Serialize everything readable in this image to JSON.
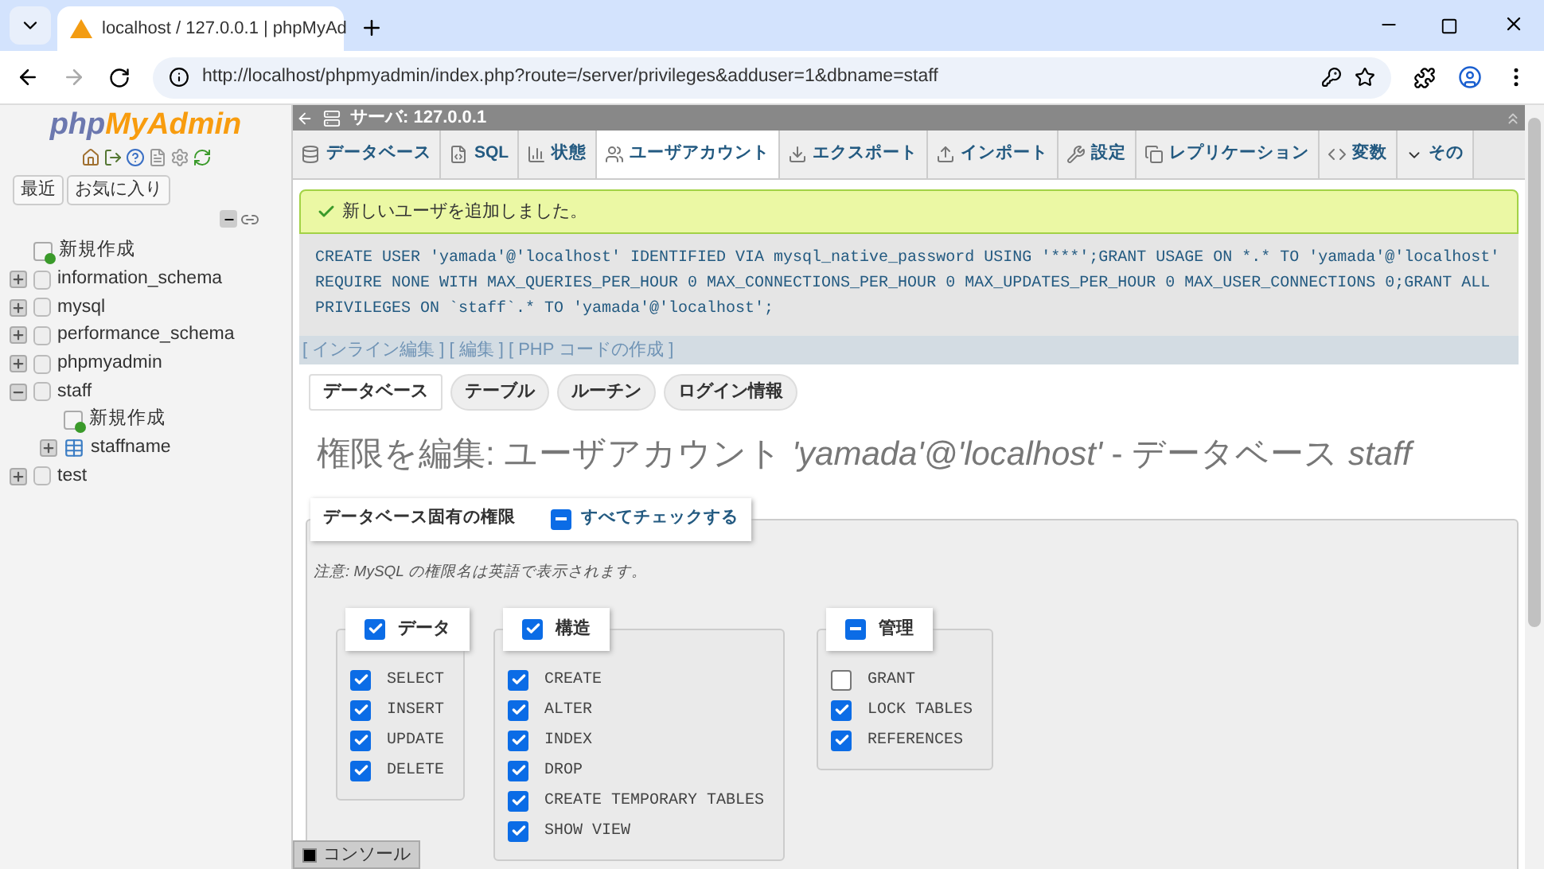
{
  "browser": {
    "tab_title": "localhost / 127.0.0.1 | phpMyAd",
    "url": "http://localhost/phpmyadmin/index.php?route=/server/privileges&adduser=1&dbname=staff"
  },
  "sidebar": {
    "logo_php": "php",
    "logo_rest": "MyAdmin",
    "buttons": [
      "最近",
      "お気に入り"
    ],
    "tree": [
      {
        "label": "新規作成",
        "kind": "new"
      },
      {
        "label": "information_schema",
        "kind": "db",
        "expanded": false
      },
      {
        "label": "mysql",
        "kind": "db",
        "expanded": false
      },
      {
        "label": "performance_schema",
        "kind": "db",
        "expanded": false
      },
      {
        "label": "phpmyadmin",
        "kind": "db",
        "expanded": false
      },
      {
        "label": "staff",
        "kind": "db",
        "expanded": true,
        "children": [
          {
            "label": "新規作成",
            "kind": "new"
          },
          {
            "label": "staffname",
            "kind": "table",
            "expanded": false
          }
        ]
      },
      {
        "label": "test",
        "kind": "db",
        "expanded": false
      }
    ]
  },
  "breadcrumb": "サーバ: 127.0.0.1",
  "tabs": [
    {
      "label": "データベース",
      "selected": false
    },
    {
      "label": "SQL",
      "selected": false
    },
    {
      "label": "状態",
      "selected": false
    },
    {
      "label": "ユーザアカウント",
      "selected": true
    },
    {
      "label": "エクスポート",
      "selected": false
    },
    {
      "label": "インポート",
      "selected": false
    },
    {
      "label": "設定",
      "selected": false
    },
    {
      "label": "レプリケーション",
      "selected": false
    },
    {
      "label": "変数",
      "selected": false
    },
    {
      "label": "その",
      "selected": false
    }
  ],
  "success_message": "新しいユーザを追加しました。",
  "sql": "CREATE USER 'yamada'@'localhost' IDENTIFIED VIA mysql_native_password USING '***';GRANT USAGE ON *.* TO 'yamada'@'localhost' REQUIRE NONE WITH MAX_QUERIES_PER_HOUR 0 MAX_CONNECTIONS_PER_HOUR 0 MAX_UPDATES_PER_HOUR 0 MAX_USER_CONNECTIONS 0;GRANT ALL PRIVILEGES ON `staff`.* TO 'yamada'@'localhost';",
  "sql_links": [
    "[ インライン編集 ]",
    "[ 編集 ]",
    "[ PHP コードの作成 ]"
  ],
  "sub_tabs": [
    {
      "label": "データベース",
      "selected": true
    },
    {
      "label": "テーブル",
      "selected": false
    },
    {
      "label": "ルーチン",
      "selected": false
    },
    {
      "label": "ログイン情報",
      "selected": false
    }
  ],
  "heading": "権限を編集: ユーザアカウント *'yamada'@'localhost'* - データベース *staff*",
  "fieldset": {
    "legend": "データベース固有の権限",
    "check_all": {
      "label": "すべてチェックする",
      "indeterminate": true
    },
    "note": "注意: MySQL の権限名は英語で表示されます。",
    "groups": [
      {
        "label": "データ",
        "checked": true,
        "items": [
          {
            "label": "SELECT",
            "checked": true
          },
          {
            "label": "INSERT",
            "checked": true
          },
          {
            "label": "UPDATE",
            "checked": true
          },
          {
            "label": "DELETE",
            "checked": true
          }
        ]
      },
      {
        "label": "構造",
        "checked": true,
        "items": [
          {
            "label": "CREATE",
            "checked": true
          },
          {
            "label": "ALTER",
            "checked": true
          },
          {
            "label": "INDEX",
            "checked": true
          },
          {
            "label": "DROP",
            "checked": true
          },
          {
            "label": "CREATE TEMPORARY TABLES",
            "checked": true
          },
          {
            "label": "SHOW VIEW",
            "checked": true
          }
        ]
      },
      {
        "label": "管理",
        "indeterminate": true,
        "items": [
          {
            "label": "GRANT",
            "checked": false
          },
          {
            "label": "LOCK TABLES",
            "checked": true
          },
          {
            "label": "REFERENCES",
            "checked": true
          }
        ]
      }
    ]
  },
  "console": "コンソール"
}
